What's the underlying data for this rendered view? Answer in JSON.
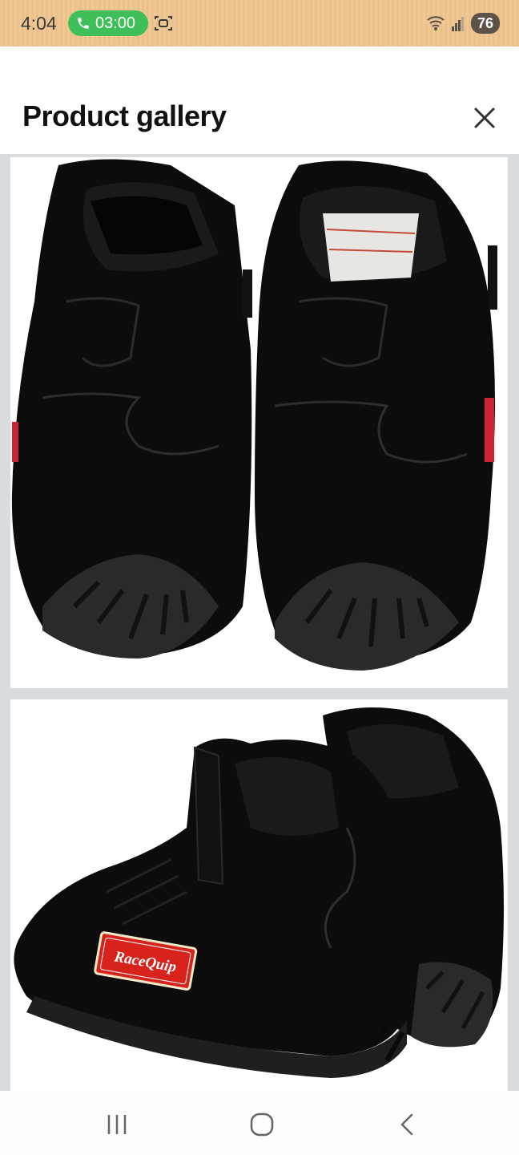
{
  "status_bar": {
    "time": "4:04",
    "call_timer": "03:00",
    "battery": "76",
    "icons": [
      "phone-icon",
      "screen-record-icon",
      "wifi-icon",
      "signal-icon",
      "battery-icon"
    ]
  },
  "header": {
    "title": "Product gallery",
    "close_icon": "close-icon"
  },
  "gallery": {
    "images": [
      {
        "name": "racing-shoes-rear-view",
        "brand_logo": ""
      },
      {
        "name": "racing-shoes-side-view",
        "brand_logo": "RaceQuip"
      }
    ]
  },
  "nav_bar": {
    "icons": [
      "recents-icon",
      "home-icon",
      "back-icon"
    ]
  },
  "colors": {
    "status_bar_bg": "#efc895",
    "call_pill": "#3fbf5a",
    "gallery_bg": "#d9dde0",
    "shoe": "#0b0b0b",
    "logo_red": "#d8231c"
  }
}
